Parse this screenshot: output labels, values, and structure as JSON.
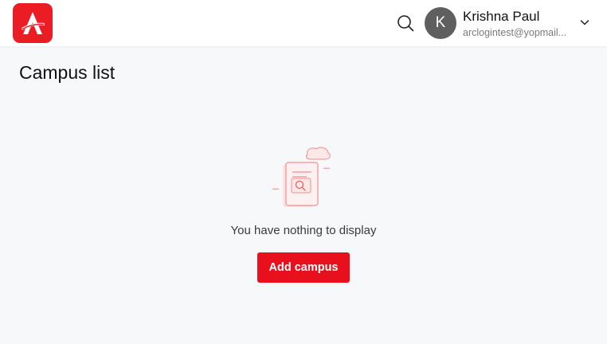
{
  "header": {
    "user": {
      "initial": "K",
      "name": "Krishna Paul",
      "email": "arclogintest@yopmail..."
    }
  },
  "main": {
    "title": "Campus list",
    "empty_state": {
      "message": "You have nothing to display",
      "button_label": "Add campus"
    }
  },
  "colors": {
    "brand": "#ec1c24",
    "primary_button": "#e8101c",
    "background": "#f7f8fa"
  },
  "icons": [
    "logo-icon",
    "search-icon",
    "chevron-down-icon",
    "empty-document-illustration"
  ]
}
